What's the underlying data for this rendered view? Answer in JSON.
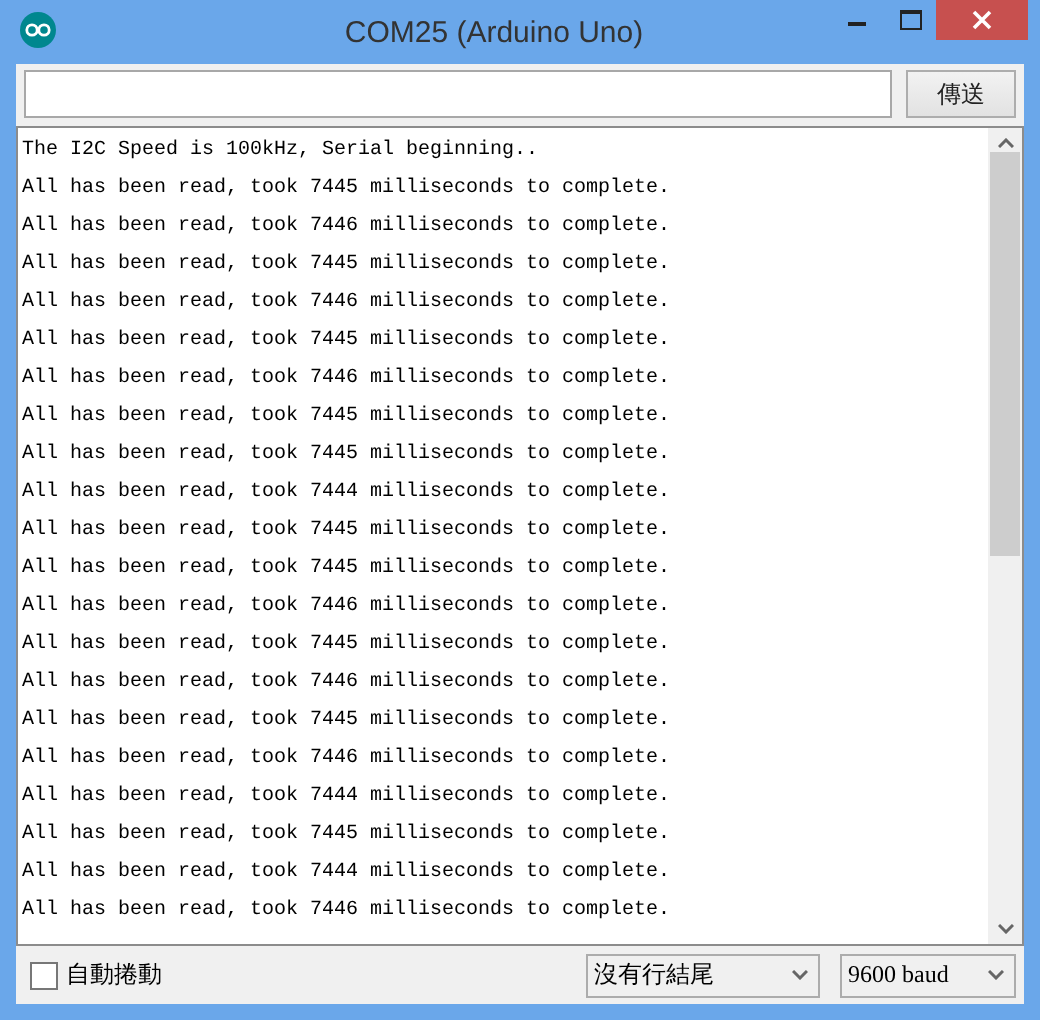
{
  "window": {
    "title": "COM25 (Arduino Uno)"
  },
  "send_button": {
    "label": "傳送"
  },
  "output_lines": [
    "The I2C Speed is 100kHz, Serial beginning..",
    "All has been read, took 7445 milliseconds to complete.",
    "All has been read, took 7446 milliseconds to complete.",
    "All has been read, took 7445 milliseconds to complete.",
    "All has been read, took 7446 milliseconds to complete.",
    "All has been read, took 7445 milliseconds to complete.",
    "All has been read, took 7446 milliseconds to complete.",
    "All has been read, took 7445 milliseconds to complete.",
    "All has been read, took 7445 milliseconds to complete.",
    "All has been read, took 7444 milliseconds to complete.",
    "All has been read, took 7445 milliseconds to complete.",
    "All has been read, took 7445 milliseconds to complete.",
    "All has been read, took 7446 milliseconds to complete.",
    "All has been read, took 7445 milliseconds to complete.",
    "All has been read, took 7446 milliseconds to complete.",
    "All has been read, took 7445 milliseconds to complete.",
    "All has been read, took 7446 milliseconds to complete.",
    "All has been read, took 7444 milliseconds to complete.",
    "All has been read, took 7445 milliseconds to complete.",
    "All has been read, took 7444 milliseconds to complete.",
    "All has been read, took 7446 milliseconds to complete."
  ],
  "autoscroll": {
    "label": "自動捲動",
    "checked": false
  },
  "line_ending": {
    "value": "沒有行結尾"
  },
  "baud_rate": {
    "value": "9600 baud"
  }
}
